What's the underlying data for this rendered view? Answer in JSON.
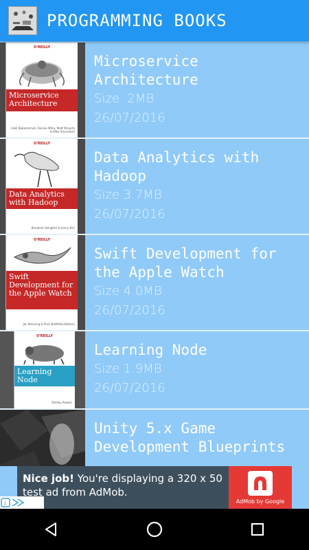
{
  "app": {
    "title": "PROGRAMMING BOOKS"
  },
  "books": [
    {
      "title": "Microservice Architecture",
      "size": "Size .2MB",
      "date": "26/07/2016",
      "cover_title": "Microservice Architecture"
    },
    {
      "title": "Data Analytics with Hadoop",
      "size": "Size 3.7MB",
      "date": "26/07/2016",
      "cover_title": "Data Analytics with Hadoop"
    },
    {
      "title": "Swift Development for the Apple Watch",
      "size": "Size 4.0MB",
      "date": "26/07/2016",
      "cover_title": "Swift Development for the Apple Watch"
    },
    {
      "title": "Learning Node",
      "size": "Size 1.9MB",
      "date": "26/07/2016",
      "cover_title": "Learning Node"
    },
    {
      "title": "Unity 5.x Game Development Blueprints",
      "size": "",
      "date": ""
    }
  ],
  "ad": {
    "headline": "Nice job!",
    "body": " You're displaying a 320 x 50 test ad from AdMob.",
    "brand": "AdMob by Google"
  },
  "icons": {
    "app_logo": "app-logo-icon",
    "back": "back-triangle-icon",
    "home": "home-circle-icon",
    "recents": "recents-square-icon",
    "adchoices": "adchoices-icon"
  },
  "colors": {
    "appbar": "#2196f3",
    "list_bg": "#90caf9",
    "ad_bg": "#3d4f5c",
    "ad_accent": "#e53935"
  }
}
